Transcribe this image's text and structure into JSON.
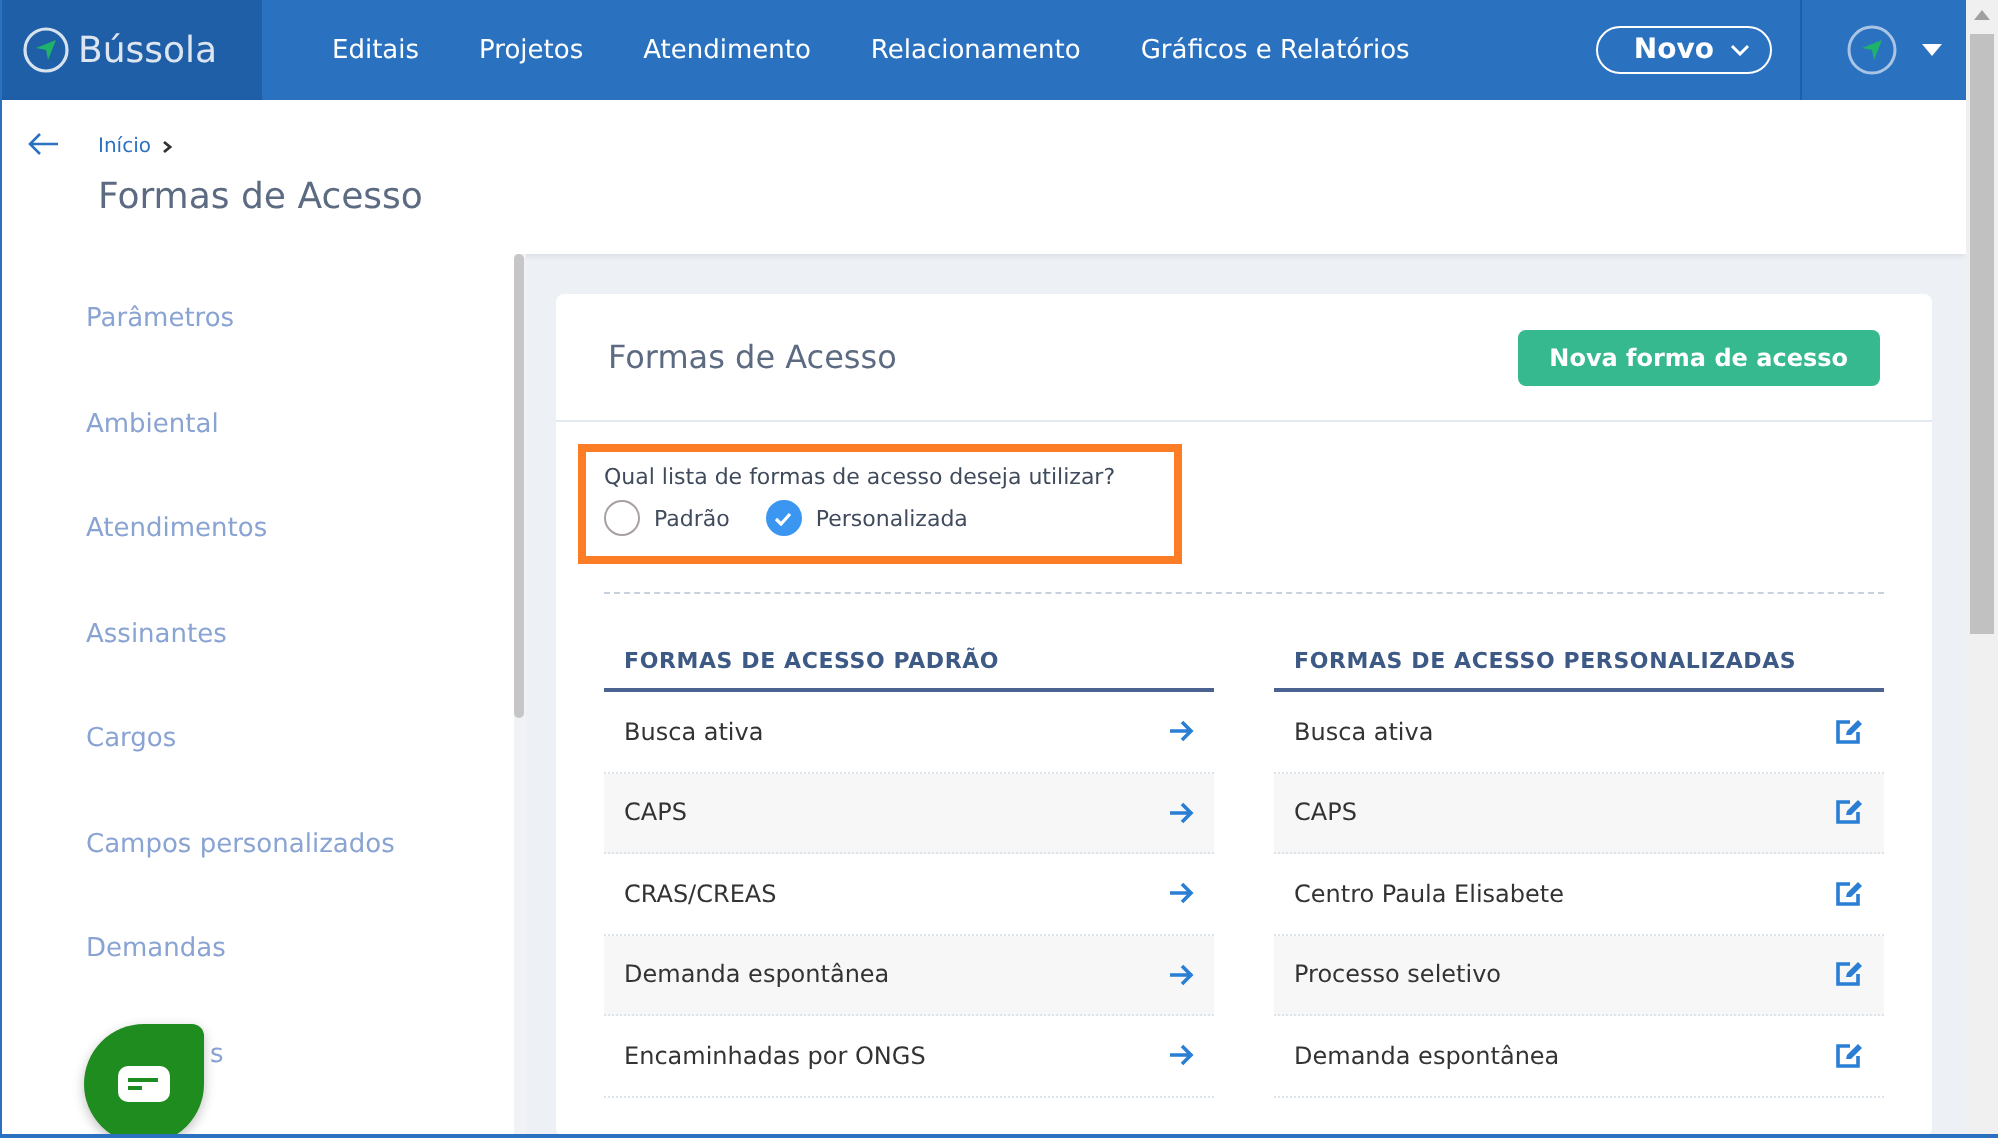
{
  "header": {
    "logo": "Bússola",
    "nav": [
      {
        "label": "Editais"
      },
      {
        "label": "Projetos"
      },
      {
        "label": "Atendimento"
      },
      {
        "label": "Relacionamento"
      },
      {
        "label": "Gráficos e Relatórios"
      }
    ],
    "new_button": "Novo"
  },
  "breadcrumb": [
    "Início"
  ],
  "page_title": "Formas de Acesso",
  "sidebar": {
    "items": [
      {
        "label": "Parâmetros",
        "covered": false
      },
      {
        "label": "Ambiental",
        "covered": false
      },
      {
        "label": "Atendimentos",
        "covered": false
      },
      {
        "label": "Assinantes",
        "covered": false
      },
      {
        "label": "Cargos",
        "covered": false
      },
      {
        "label": "Campos personalizados",
        "covered": false
      },
      {
        "label": "Demandas",
        "covered": false
      },
      {
        "label": "s",
        "covered": true
      }
    ]
  },
  "card": {
    "title": "Formas de Acesso",
    "action_button": "Nova forma de acesso",
    "question": "Qual lista de formas de acesso deseja utilizar?",
    "options": [
      {
        "label": "Padrão",
        "selected": false
      },
      {
        "label": "Personalizada",
        "selected": true
      }
    ],
    "lists": [
      {
        "kind": "default",
        "heading": "FORMAS DE ACESSO PADRÃO",
        "rows": [
          "Busca ativa",
          "CAPS",
          "CRAS/CREAS",
          "Demanda espontânea",
          "Encaminhadas por ONGS"
        ]
      },
      {
        "kind": "custom",
        "heading": "FORMAS DE ACESSO PERSONALIZADAS",
        "rows": [
          "Busca ativa",
          "CAPS",
          "Centro Paula Elisabete",
          "Processo seletivo",
          "Demanda espontânea"
        ]
      }
    ]
  }
}
